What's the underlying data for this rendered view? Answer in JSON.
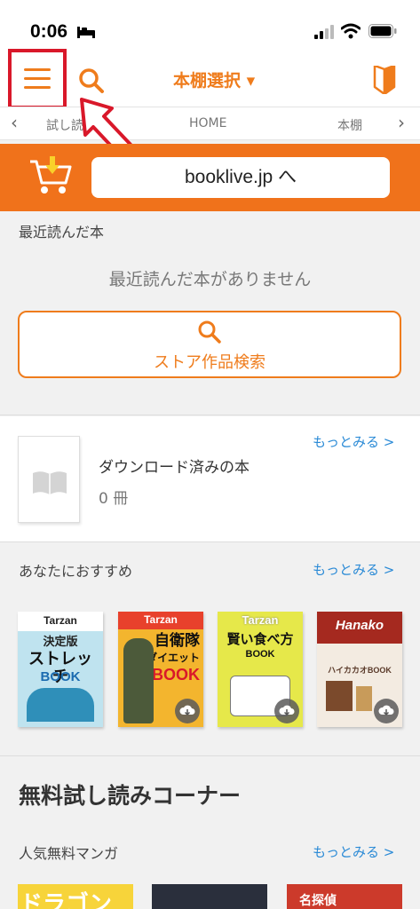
{
  "status_bar": {
    "time": "0:06"
  },
  "header": {
    "shelf_select_label": "本棚選択 ▾"
  },
  "tabs": {
    "prev": "‹",
    "next": "›",
    "items": [
      {
        "label": "試し読み"
      },
      {
        "label": "HOME"
      },
      {
        "label": "本棚"
      }
    ]
  },
  "banner": {
    "link_label": "booklive.jp へ"
  },
  "recent": {
    "title": "最近読んだ本",
    "empty_message": "最近読んだ本がありません",
    "store_search_label": "ストア作品検索"
  },
  "download": {
    "title": "ダウンロード済みの本",
    "count": "0 冊",
    "more": "もっとみる >"
  },
  "recommend": {
    "title": "あなたにおすすめ",
    "more": "もっとみる >",
    "covers": [
      {
        "brand": "Tarzan",
        "headline": "決定版",
        "main": "ストレッチ",
        "sub": "BOOK"
      },
      {
        "brand": "Tarzan",
        "headline": "自衛隊",
        "main": "ダイエット",
        "sub": "BOOK"
      },
      {
        "brand": "Tarzan",
        "headline": "賢い食べ方",
        "main": "",
        "sub": "BOOK"
      },
      {
        "brand": "Hanako",
        "headline": "ハイカカオBOOK",
        "main": "",
        "sub": ""
      }
    ]
  },
  "free_corner": {
    "title": "無料試し読みコーナー",
    "manga_title": "人気無料マンガ",
    "manga_more": "もっとみる >",
    "manga_covers": [
      {
        "text": "ドラゴン"
      },
      {
        "text": ""
      },
      {
        "text": "名探偵"
      }
    ]
  },
  "colors": {
    "accent": "#ef7c1c",
    "banner": "#f0721b",
    "link": "#2a8ad6",
    "highlight": "#d9182a"
  }
}
